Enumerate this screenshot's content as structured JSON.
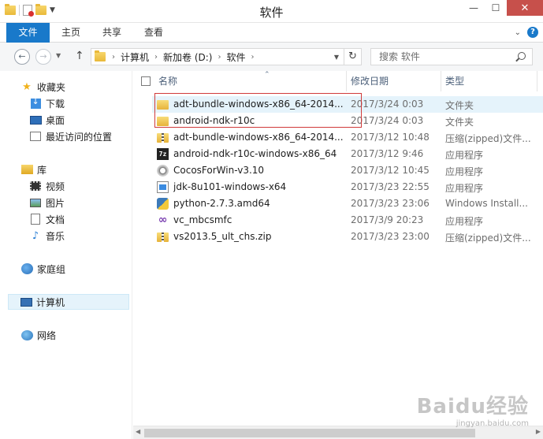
{
  "window": {
    "title": "软件"
  },
  "ribbon": {
    "tabs": [
      "文件",
      "主页",
      "共享",
      "查看"
    ]
  },
  "address": {
    "crumbs": [
      "计算机",
      "新加卷 (D:)",
      "软件"
    ]
  },
  "search": {
    "placeholder": "搜索 软件"
  },
  "sidebar": {
    "favorites": {
      "label": "收藏夹",
      "items": [
        "下载",
        "桌面",
        "最近访问的位置"
      ]
    },
    "libraries": {
      "label": "库",
      "items": [
        "视频",
        "图片",
        "文档",
        "音乐"
      ]
    },
    "homegroup": "家庭组",
    "computer": "计算机",
    "network": "网络"
  },
  "columns": {
    "name": "名称",
    "date": "修改日期",
    "type": "类型"
  },
  "files": [
    {
      "name": "adt-bundle-windows-x86_64-2014...",
      "date": "2017/3/24 0:03",
      "type": "文件夹",
      "icon": "folder-icon"
    },
    {
      "name": "android-ndk-r10c",
      "date": "2017/3/24 0:03",
      "type": "文件夹",
      "icon": "folder-icon"
    },
    {
      "name": "adt-bundle-windows-x86_64-2014...",
      "date": "2017/3/12 10:48",
      "type": "压缩(zipped)文件...",
      "icon": "zip-icon"
    },
    {
      "name": "android-ndk-r10c-windows-x86_64",
      "date": "2017/3/12 9:46",
      "type": "应用程序",
      "icon": "7z-icon"
    },
    {
      "name": "CocosForWin-v3.10",
      "date": "2017/3/12 10:45",
      "type": "应用程序",
      "icon": "cocos-icon"
    },
    {
      "name": "jdk-8u101-windows-x64",
      "date": "2017/3/23 22:55",
      "type": "应用程序",
      "icon": "exe-icon"
    },
    {
      "name": "python-2.7.3.amd64",
      "date": "2017/3/23 23:06",
      "type": "Windows Install...",
      "icon": "python-icon"
    },
    {
      "name": "vc_mbcsmfc",
      "date": "2017/3/9 20:23",
      "type": "应用程序",
      "icon": "vs-icon"
    },
    {
      "name": "vs2013.5_ult_chs.zip",
      "date": "2017/3/23 23:00",
      "type": "压缩(zipped)文件...",
      "icon": "zip-icon"
    }
  ],
  "watermark": {
    "main": "Baidu经验",
    "sub": "jingyan.baidu.com"
  },
  "colors": {
    "accent": "#1979ca",
    "highlight": "#d03a3a",
    "close": "#c7504b"
  }
}
